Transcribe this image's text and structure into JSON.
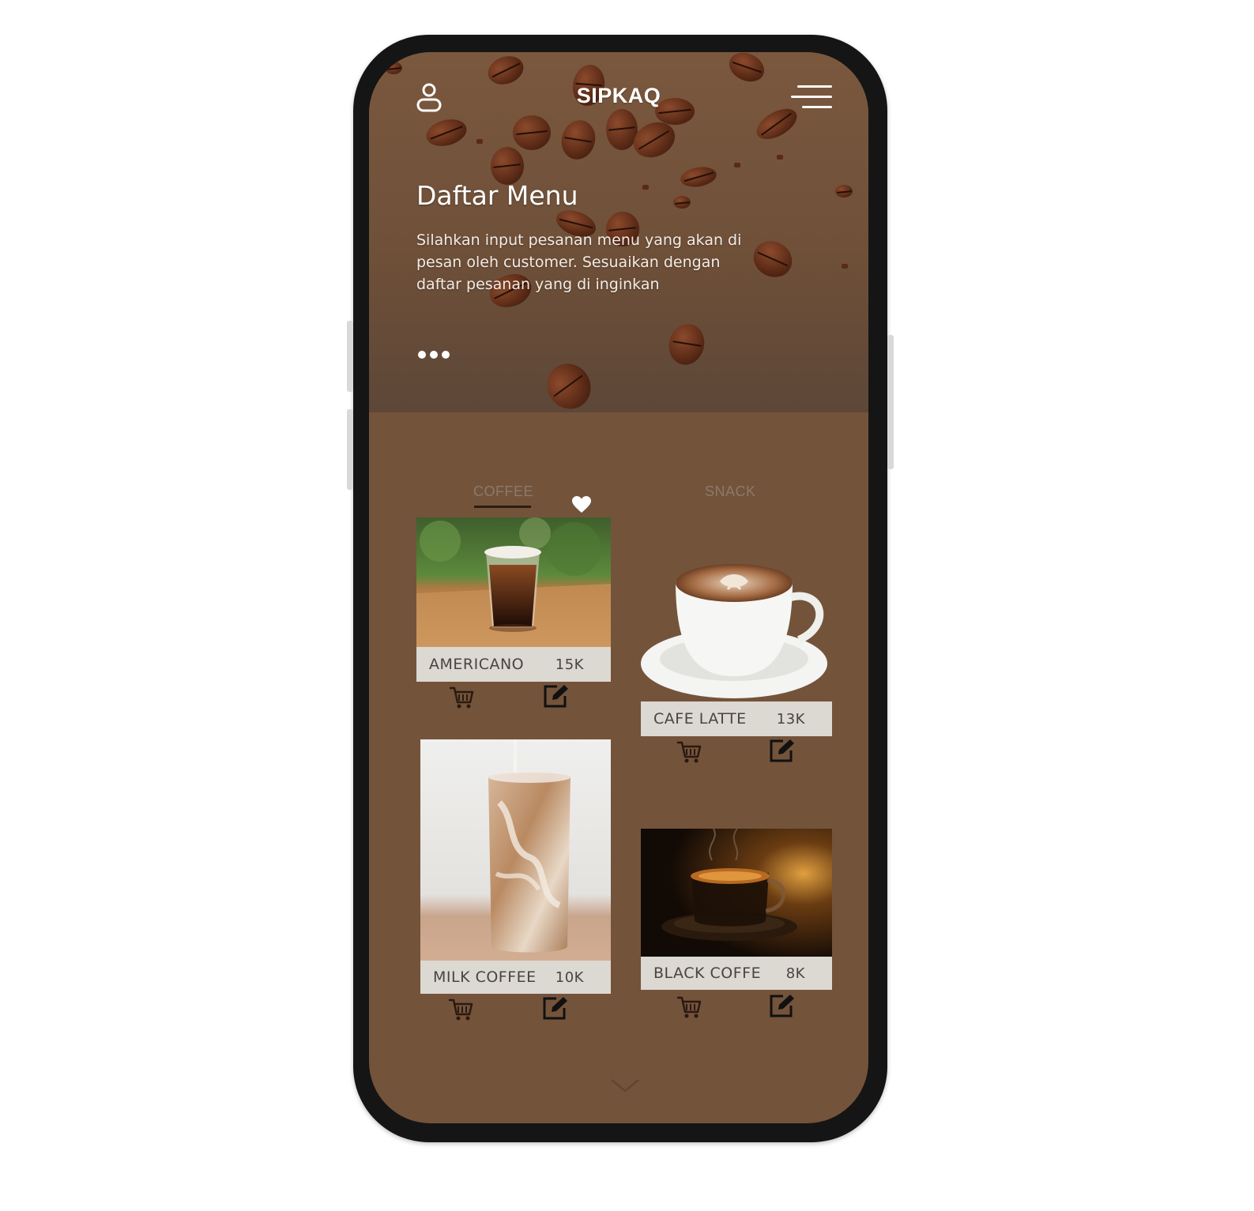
{
  "app": {
    "title": "SIPKAQ"
  },
  "hero": {
    "title": "Daftar Menu",
    "description": "Silahkan input pesanan menu yang akan di pesan oleh customer. Sesuaikan dengan daftar pesanan yang di inginkan"
  },
  "tabs": [
    {
      "label": "COFFEE",
      "active": true
    },
    {
      "label": "SNACK",
      "active": false
    }
  ],
  "menu_items": [
    {
      "name": "AMERICANO",
      "price": "15K"
    },
    {
      "name": "CAFE LATTE",
      "price": "13K"
    },
    {
      "name": "MILK COFFEE",
      "price": "10K"
    },
    {
      "name": "BLACK COFFE",
      "price": "8K"
    }
  ],
  "icons": {
    "profile": "user-icon",
    "menu": "hamburger-menu-icon",
    "favorite": "heart-icon",
    "cart": "cart-icon",
    "edit": "edit-icon",
    "scroll": "chevron-down-icon",
    "more": "more-dots-icon"
  },
  "colors": {
    "background": "#74533b",
    "label_bar": "#dcd8d2",
    "text_light": "#ffffff"
  }
}
